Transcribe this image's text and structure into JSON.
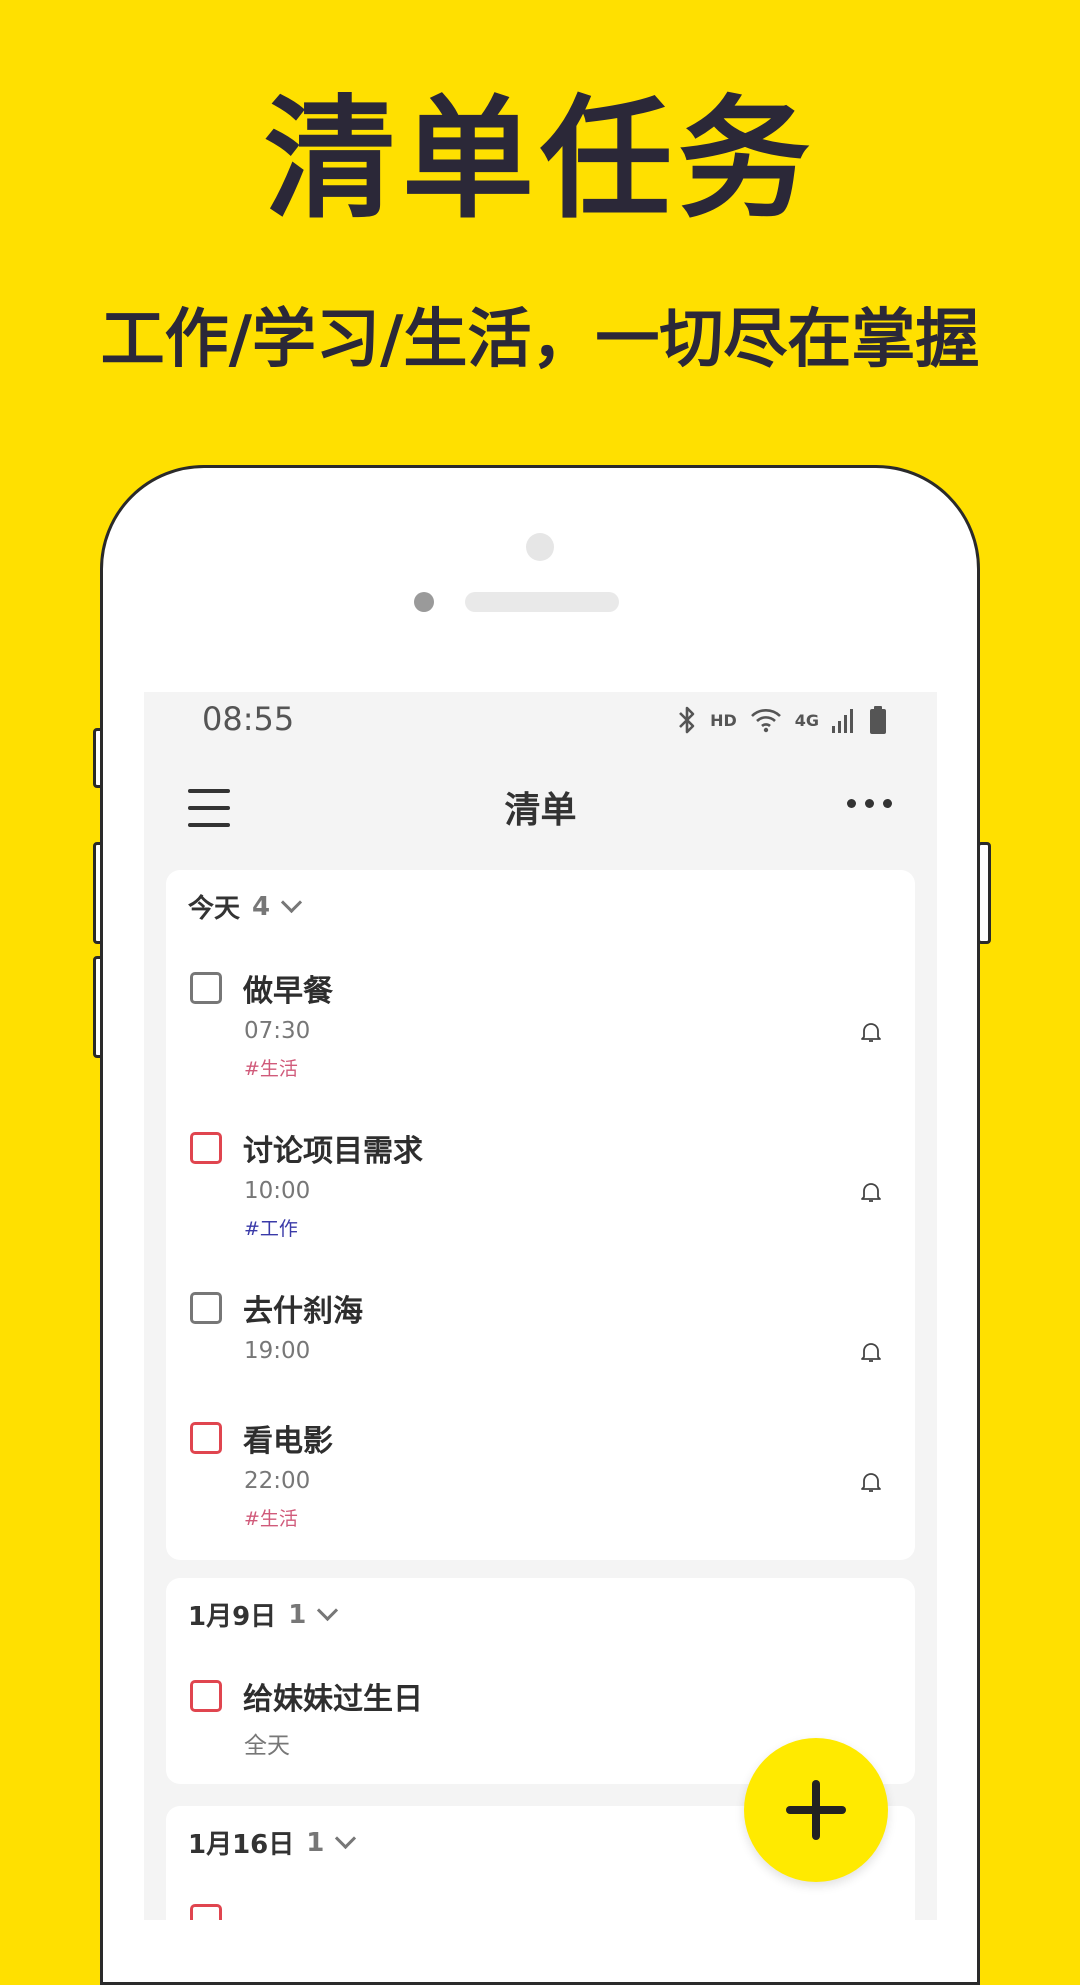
{
  "promo": {
    "title": "清单任务",
    "subtitle": "工作/学习/生活，一切尽在掌握"
  },
  "status_bar": {
    "time": "08:55",
    "hd": "HD",
    "network": "4G",
    "icons": [
      "bluetooth-icon",
      "wifi-icon",
      "signal-icon",
      "battery-icon"
    ]
  },
  "app_bar": {
    "title": "清单",
    "menu_icon": "menu-icon",
    "more_icon": "more-icon"
  },
  "sections": [
    {
      "label": "今天",
      "count": "4",
      "tasks": [
        {
          "title": "做早餐",
          "time": "07:30",
          "tag": "#生活",
          "reminder": true,
          "priority": "none"
        },
        {
          "title": "讨论项目需求",
          "time": "10:00",
          "tag": "#工作",
          "reminder": true,
          "priority": "high"
        },
        {
          "title": "去什刹海",
          "time": "19:00",
          "tag": "",
          "reminder": true,
          "priority": "none"
        },
        {
          "title": "看电影",
          "time": "22:00",
          "tag": "#生活",
          "reminder": true,
          "priority": "high"
        }
      ]
    },
    {
      "label": "1月9日",
      "count": "1",
      "tasks": [
        {
          "title": "给妹妹过生日",
          "time": "全天",
          "tag": "",
          "reminder": false,
          "priority": "high"
        }
      ]
    },
    {
      "label": "1月16日",
      "count": "1",
      "tasks": []
    }
  ],
  "colors": {
    "background": "#FFE000",
    "fab": "#FFEA00",
    "priority_high": "#e0454f",
    "tag_life": "#d05a7a",
    "tag_work": "#3a3aa8"
  },
  "fab": {
    "icon": "plus-icon"
  }
}
